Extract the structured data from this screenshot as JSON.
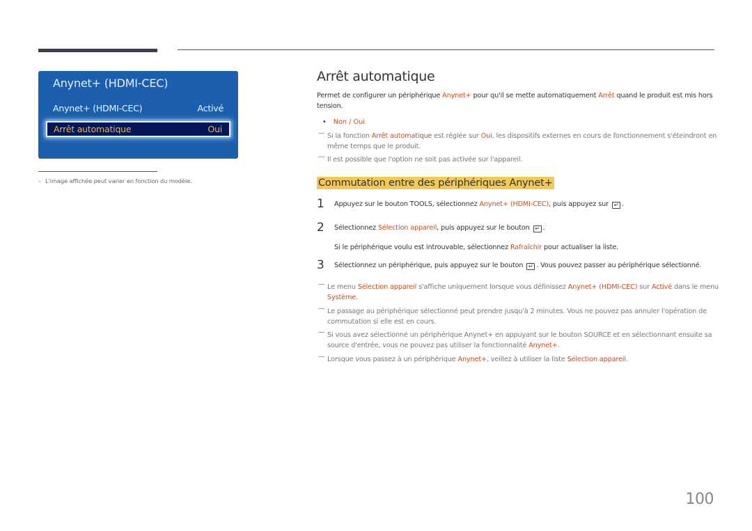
{
  "osd": {
    "title": "Anynet+ (HDMI-CEC)",
    "rows": [
      {
        "label": "Anynet+ (HDMI-CEC)",
        "value": "Activé"
      },
      {
        "label": "Arrêt automatique",
        "value": "Oui",
        "selected": true
      }
    ]
  },
  "footnote": {
    "dash": "–",
    "text": "L'image affichée peut varier en fonction du modèle."
  },
  "section1": {
    "title": "Arrêt automatique",
    "intro": [
      "Permet de configurer un périphérique ",
      "Anynet+",
      " pour qu'il se mette automatiquement ",
      "Arrêt",
      " quand le produit est mis hors tension."
    ],
    "options": "Non / Oui",
    "notes": [
      [
        "Si la fonction ",
        "Arrêt automatique",
        " est réglée sur ",
        "Oui",
        ", les dispositifs externes en cours de fonctionnement s'éteindront en même temps que le produit."
      ],
      [
        "Il est possible que l'option ne soit pas activée sur l'appareil."
      ]
    ]
  },
  "section2": {
    "title": "Commutation entre des périphériques Anynet+",
    "steps": [
      {
        "num": "1",
        "parts": [
          "Appuyez sur le bouton TOOLS, sélectionnez ",
          "Anynet+ (HDMI-CEC)",
          ", puis appuyez sur ",
          "",
          "."
        ]
      },
      {
        "num": "2",
        "parts": [
          "Sélectionnez ",
          "Sélection appareil",
          ", puis appuyez sur le bouton ",
          "",
          "."
        ]
      },
      {
        "num": "",
        "parts": [
          "Si le périphérique voulu est introuvable, sélectionnez ",
          "Rafraîchir",
          " pour actualiser la liste."
        ]
      },
      {
        "num": "3",
        "parts": [
          "Sélectionnez un périphérique, puis appuyez sur le bouton ",
          "",
          ". Vous pouvez passer au périphérique sélectionné."
        ]
      }
    ],
    "notes": [
      [
        "Le menu ",
        "Sélection appareil",
        " s'affiche uniquement lorsque vous définissez ",
        "Anynet+ (HDMI-CEC)",
        " sur ",
        "Activé",
        " dans le menu ",
        "Système",
        "."
      ],
      [
        "Le passage au périphérique sélectionné peut prendre jusqu'à 2 minutes. Vous ne pouvez pas annuler l'opération de commutation si elle est en cours."
      ],
      [
        "Si vous avez sélectionné un périphérique Anynet+ en appuyant sur le bouton SOURCE et en sélectionnant ensuite sa source d'entrée, vous ne pouvez pas utiliser la fonctionnalité ",
        "Anynet+",
        "."
      ],
      [
        "Lorsque vous passez à un périphérique ",
        "Anynet+",
        ", veillez à utiliser la liste ",
        "Sélection appareil",
        "."
      ]
    ]
  },
  "enter_icon": "enter-key-icon",
  "page_number": "100",
  "colors": {
    "highlight": "#d04a1e",
    "osd_bg": "#1c5fae",
    "osd_selected_bg": "#05155a",
    "osd_selected_text": "#f2b830",
    "heading_highlight": "#f2c955"
  }
}
